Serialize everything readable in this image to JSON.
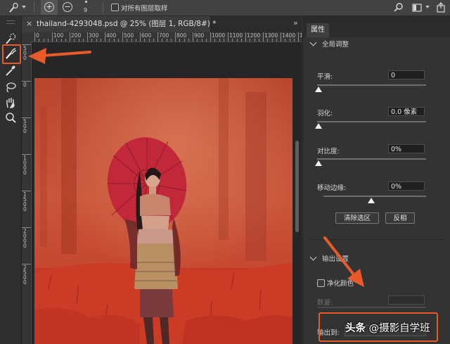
{
  "options_bar": {
    "plus_glyph": "+",
    "minus_glyph": "−",
    "brush_size": "9",
    "sample_all_layers_label": "对所有图层取样"
  },
  "document": {
    "tab_label": "thailand-4293048.psd @ 25% (图层 1, RGB/8#) *",
    "close_glyph": "×",
    "tab_overflow_glyph": "»"
  },
  "rulers": {
    "top": [
      "0",
      "100",
      "200",
      "300",
      "400",
      "500",
      "600",
      "700",
      "800",
      "900",
      "1000",
      "1100",
      "1200",
      "1300",
      "1400",
      "1500"
    ],
    "left": [
      "5\n0\n0",
      "0",
      "5\n0\n0",
      "1\n0\n0\n0",
      "1\n5\n0\n0",
      "2\n0\n0\n0",
      "2\n5\n0\n0"
    ]
  },
  "panel": {
    "tab_label": "属性",
    "global_section": {
      "title": "全局调整",
      "rows": [
        {
          "label": "平滑:",
          "value": "0",
          "knob": 0.0
        },
        {
          "label": "羽化:",
          "value": "0.0 像素",
          "knob": 0.0
        },
        {
          "label": "对比度:",
          "value": "0%",
          "knob": 0.0
        },
        {
          "label": "移动边缘:",
          "value": "0%",
          "knob": 0.5
        }
      ],
      "clear_selection_button": "清除选区",
      "invert_button": "反相"
    },
    "output_section": {
      "title": "输出设置",
      "decontaminate_label": "净化颜色",
      "amount_label": "数量:",
      "output_to_label": "输出到:"
    }
  },
  "watermark": {
    "prefix": "头条",
    "suffix": " @摄影自学班"
  },
  "colors": {
    "annotation": "#e85a2a",
    "overlay": "#c8402a"
  }
}
